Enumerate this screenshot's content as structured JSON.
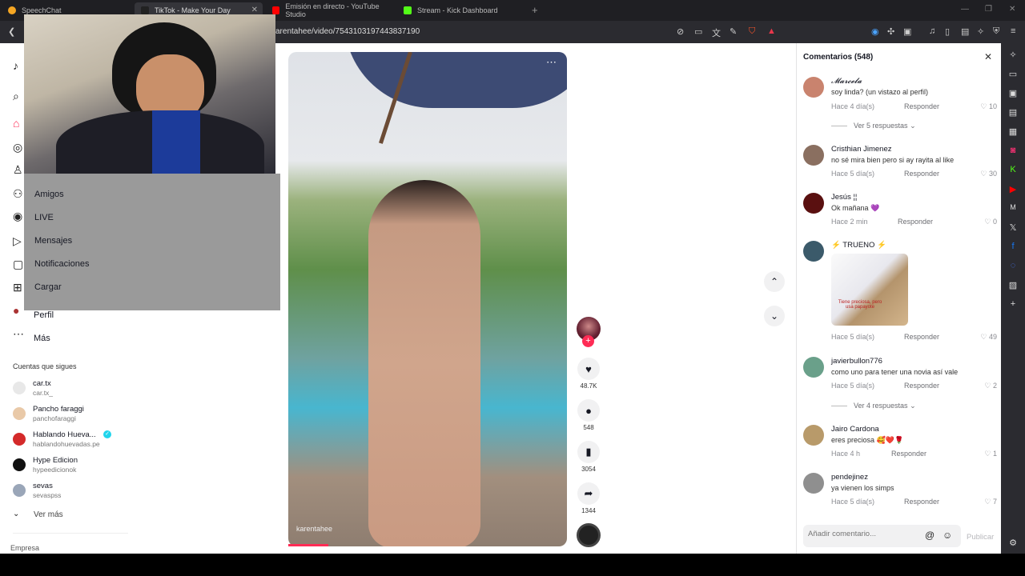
{
  "browser": {
    "tabs": [
      {
        "label": "SpeechChat",
        "color": "#f5a623"
      },
      {
        "label": "TikTok - Make Your Day",
        "color": "#222222"
      },
      {
        "label": "Emisión en directo - YouTube Studio",
        "color": "#ff0000"
      },
      {
        "label": "Stream - Kick Dashboard",
        "color": "#53fc18"
      }
    ],
    "url": "arentahee/video/7543103197443837190"
  },
  "nav": {
    "items": [
      {
        "label": "Amigos",
        "icon": "friends-icon"
      },
      {
        "label": "LIVE",
        "icon": "live-icon"
      },
      {
        "label": "Mensajes",
        "icon": "messages-icon"
      },
      {
        "label": "Notificaciones",
        "icon": "notifications-icon"
      },
      {
        "label": "Cargar",
        "icon": "upload-icon"
      },
      {
        "label": "Perfil",
        "icon": "profile-icon"
      },
      {
        "label": "Más",
        "icon": "more-icon"
      }
    ],
    "following_header": "Cuentas que sigues",
    "following": [
      {
        "name": "car.tx",
        "handle": "car.tx_"
      },
      {
        "name": "Pancho faraggi",
        "handle": "panchofaraggi"
      },
      {
        "name": "Hablando Hueva...",
        "handle": "hablandohuevadas.pe"
      },
      {
        "name": "Hype Edicion",
        "handle": "hypeedicionok"
      },
      {
        "name": "sevas",
        "handle": "sevaspss"
      }
    ],
    "see_more": "Ver más",
    "company": "Empresa"
  },
  "video": {
    "handle": "karentahee",
    "likes": "48.7K",
    "comments": "548",
    "saves": "3054",
    "shares": "1344"
  },
  "comments": {
    "title": "Comentarios (548)",
    "reply_label": "Responder",
    "items": [
      {
        "name": "𝓜𝓪𝓻𝓬𝓮𝓵𝓪",
        "text": "soy linda? (un vistazo al perfil)",
        "time": "Hace 4 día(s)",
        "likes": "10",
        "more_replies": "Ver 5 respuestas"
      },
      {
        "name": "Cristhian Jimenez",
        "text": "no sé mira bien pero si ay rayita al like",
        "time": "Hace 5 día(s)",
        "likes": "30"
      },
      {
        "name": "Jesús ¦¦",
        "text": "Ok mañana 💜",
        "time": "Hace 2 min",
        "likes": "0"
      },
      {
        "name": "⚡ TRUENO ⚡",
        "text": "",
        "sticker_caption": "Tiene preciosa, pero usa papayote",
        "time": "Hace 5 día(s)",
        "likes": "49"
      },
      {
        "name": "javierbullon776",
        "text": "como uno para tener una novia así vale",
        "time": "Hace 5 día(s)",
        "likes": "2",
        "more_replies": "Ver 4 respuestas"
      },
      {
        "name": "Jairo Cardona",
        "text": "eres preciosa 🥰❤️🌹",
        "time": "Hace 4 h",
        "likes": "1"
      },
      {
        "name": "pendejinez",
        "text": "ya vienen los simps",
        "time": "Hace 5 día(s)",
        "likes": "7"
      }
    ],
    "input_placeholder": "Añadir comentario...",
    "publish": "Publicar"
  }
}
